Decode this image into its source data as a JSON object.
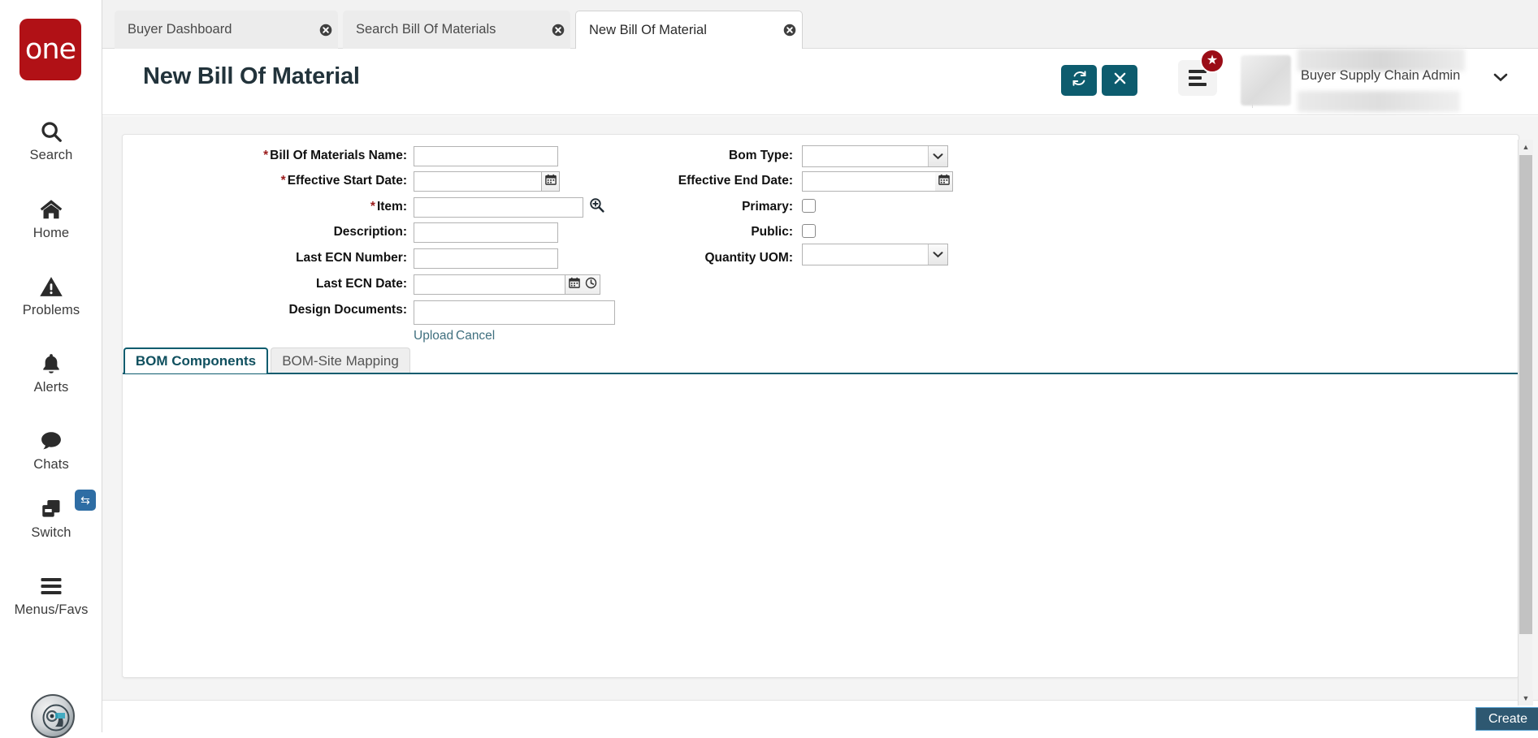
{
  "brand": {
    "logo_text": "one"
  },
  "sidebar": {
    "items": [
      {
        "label": "Search",
        "icon": "search-icon"
      },
      {
        "label": "Home",
        "icon": "home-icon"
      },
      {
        "label": "Problems",
        "icon": "warning-icon"
      },
      {
        "label": "Alerts",
        "icon": "bell-icon"
      },
      {
        "label": "Chats",
        "icon": "chat-bubble-icon"
      },
      {
        "label": "Switch",
        "icon": "switch-windows-icon"
      },
      {
        "label": "Menus/Favs",
        "icon": "hamburger-icon"
      }
    ],
    "switch_badge_icon": "swap-arrows-icon",
    "assistant_icon": "ai-assistant-orb-icon"
  },
  "tabs": [
    {
      "label": "Buyer Dashboard",
      "active": false
    },
    {
      "label": "Search Bill Of Materials",
      "active": false
    },
    {
      "label": "New Bill Of Material",
      "active": true
    }
  ],
  "header": {
    "title": "New Bill Of Material",
    "refresh_icon": "refresh-icon",
    "close_icon": "close-x-icon",
    "menu_icon": "hamburger-menu-icon",
    "favorites_badge_icon": "star-badge-icon",
    "user_role": "Buyer Supply Chain Admin",
    "user_caret_icon": "chevron-down-icon"
  },
  "form": {
    "left_fields": [
      {
        "label": "Bill Of Materials Name:",
        "required": true,
        "value": "",
        "type": "text"
      },
      {
        "label": "Effective Start Date:",
        "required": true,
        "value": "",
        "type": "date"
      },
      {
        "label": "Item:",
        "required": true,
        "value": "",
        "type": "lookup"
      },
      {
        "label": "Description:",
        "required": false,
        "value": "",
        "type": "text"
      },
      {
        "label": "Last ECN Number:",
        "required": false,
        "value": "",
        "type": "text"
      },
      {
        "label": "Last ECN Date:",
        "required": false,
        "value": "",
        "type": "datetime"
      },
      {
        "label": "Design Documents:",
        "required": false,
        "value": "",
        "type": "file"
      }
    ],
    "right_fields": [
      {
        "label": "Bom Type:",
        "required": false,
        "value": "",
        "type": "select"
      },
      {
        "label": "Effective End Date:",
        "required": false,
        "value": "",
        "type": "date"
      },
      {
        "label": "Primary:",
        "required": false,
        "value": "",
        "type": "checkbox",
        "checked": false
      },
      {
        "label": "Public:",
        "required": false,
        "value": "",
        "type": "checkbox",
        "checked": false
      },
      {
        "label": "Quantity UOM:",
        "required": false,
        "value": "",
        "type": "select"
      }
    ],
    "upload_link": "Upload",
    "cancel_link": "Cancel",
    "calendar_icon": "calendar-icon",
    "clock_icon": "clock-icon",
    "lookup_icon": "magnifier-plus-icon",
    "dropdown_icon": "chevron-down-icon"
  },
  "panel_tabs": [
    {
      "label": "BOM Components",
      "active": true
    },
    {
      "label": "BOM-Site Mapping",
      "active": false
    }
  ],
  "footer": {
    "create_label": "Create"
  },
  "scrollbar": {
    "up_icon": "caret-up-icon",
    "down_icon": "caret-down-icon"
  },
  "colors": {
    "brand_red": "#b11116",
    "teal": "#0d5c6e",
    "link": "#40707f",
    "create_bg": "#2e5871",
    "required_star": "#9b1c1c"
  }
}
